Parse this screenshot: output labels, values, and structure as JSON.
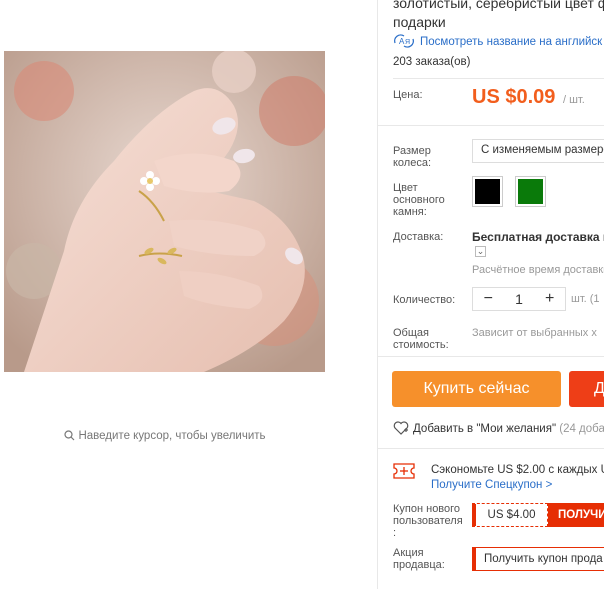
{
  "product": {
    "title_line1": "золотистый, серебристый цвет ф",
    "title_line2": "подарки",
    "translate_link": "Посмотреть название на английск",
    "orders": "203 заказа(ов)",
    "price_label": "Цена:",
    "price": "US $0.09",
    "price_unit": "/ шт."
  },
  "gallery": {
    "zoom_hint": "Наведите курсор, чтобы увеличить"
  },
  "options": {
    "size_label": "Размер колеса:",
    "size_value": "С изменяемым размером",
    "color_label": "Цвет основного камня:",
    "colors": [
      "#000000",
      "#0a7a0a"
    ]
  },
  "shipping": {
    "label": "Доставка:",
    "value": "Бесплатная доставка в",
    "estimate": "Расчётное время доставки"
  },
  "quantity": {
    "label": "Количество:",
    "minus": "−",
    "value": "1",
    "plus": "+",
    "unit": "шт. (1"
  },
  "total": {
    "label": "Общая стоимость:",
    "value": "Зависит от выбранных х"
  },
  "actions": {
    "buy_now": "Купить сейчас",
    "add_to_cart": "Д",
    "wishlist": "Добавить в \"Мои желания\"",
    "wishlist_count": "(24 добав"
  },
  "coupons": {
    "save_text": "Сэкономьте US $2.00 с каждых U",
    "get_coupon": "Получите Спецкупон >",
    "new_user_label": "Купон нового пользователя :",
    "new_user_amount": "US $4.00",
    "new_user_button": "ПОЛУЧИ",
    "seller_label": "Акция продавца:",
    "seller_button": "Получить купон прода"
  },
  "colors": {
    "price": "#f25e1d",
    "buy_button": "#f6902b",
    "cart_button": "#ee3e17",
    "link": "#2a6ec8",
    "coupon_red": "#e62e04"
  }
}
